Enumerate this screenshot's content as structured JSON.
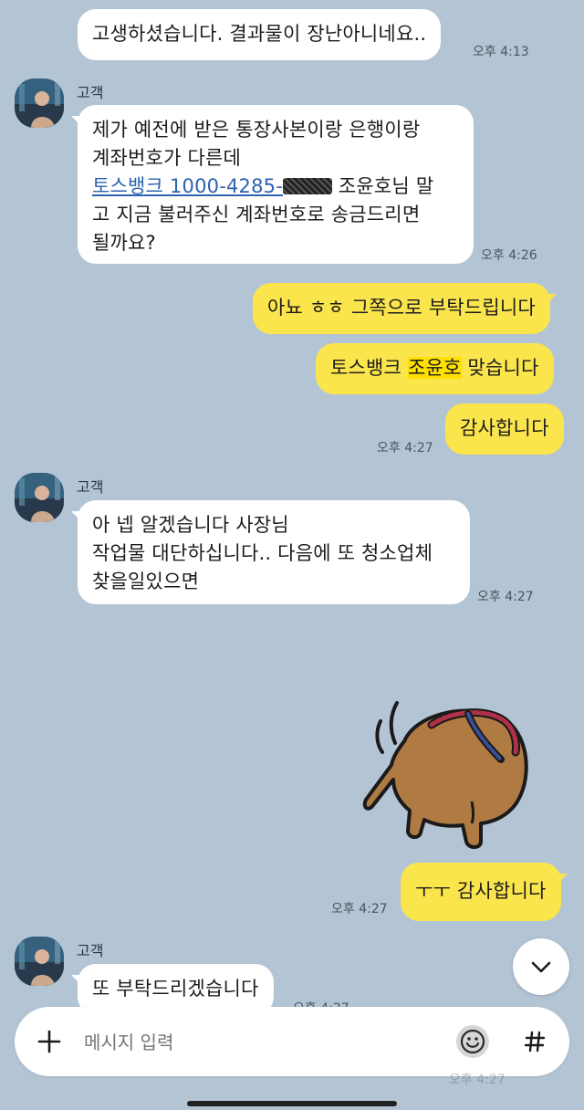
{
  "messages": {
    "m1": {
      "text": "고생하셨습니다. 결과물이 장난아니네요..",
      "time": "오후 4:13"
    },
    "m2": {
      "sender": "고객",
      "line1": "제가 예전에 받은 통장사본이랑 은행이랑",
      "line2": "계좌번호가 다른데",
      "link_text": "토스뱅크 1000-4285-",
      "line3_rest": " 조윤호님 말",
      "line4": "고 지금 불러주신 계좌번호로 송금드리면",
      "line5": "될까요?",
      "time": "오후 4:26"
    },
    "m3": {
      "text": "아뇨 ㅎㅎ 그쪽으로 부탁드립니다"
    },
    "m4": {
      "pre": "토스뱅크 ",
      "highlight": "조윤호",
      "post": " 맞습니다"
    },
    "m5": {
      "text": "감사합니다",
      "time": "오후 4:27"
    },
    "m6": {
      "sender": "고객",
      "line1": "아 넵 알겠습니다 사장님",
      "line2": "작업물 대단하십니다.. 다음에 또 청소업체",
      "line3": "찾을일있으면",
      "time": "오후 4:27"
    },
    "m7": {
      "text": "ㅜㅜ 감사합니다",
      "time": "오후 4:27"
    },
    "m8": {
      "sender": "고객",
      "text": "또 부탁드리겠습니다",
      "time": "오후 4:27"
    }
  },
  "sticker": {
    "icon": "bear-sticker-icon"
  },
  "input": {
    "placeholder": "메시지 입력"
  },
  "icons": {
    "plus": "plus-icon",
    "emoji": "emoji-icon",
    "hash": "hash-icon",
    "scroll_down": "chevron-down-icon"
  },
  "colors": {
    "background": "#b3c4d5",
    "outgoing": "#fbe54d",
    "incoming": "#ffffff",
    "link": "#2d62b0"
  }
}
